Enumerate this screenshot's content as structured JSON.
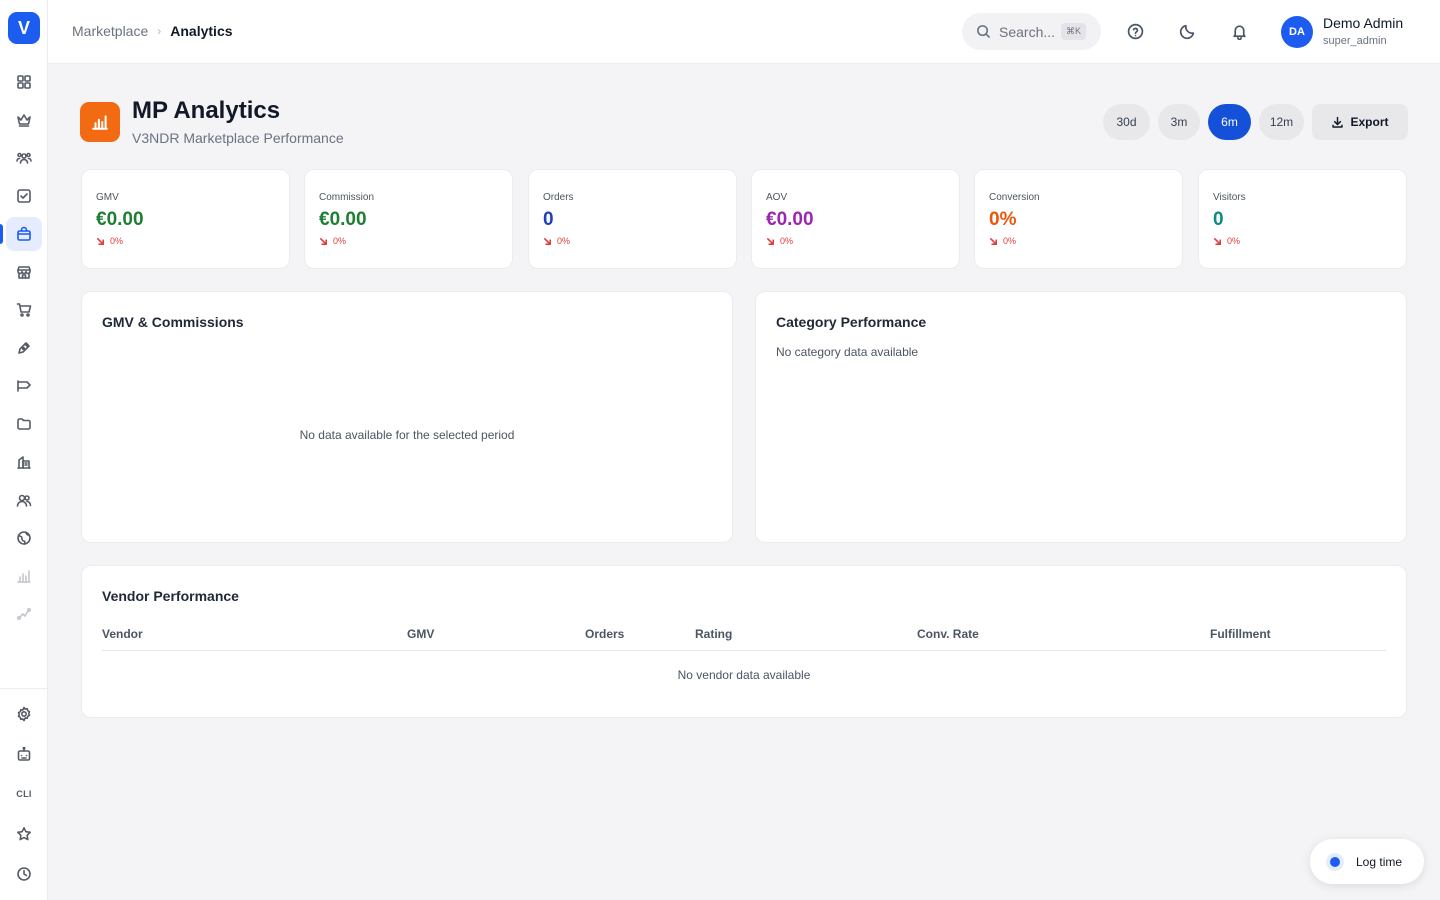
{
  "app": {
    "logo_letter": "V"
  },
  "breadcrumb": {
    "parent": "Marketplace",
    "current": "Analytics"
  },
  "search": {
    "placeholder": "Search...",
    "shortcut": "⌘K"
  },
  "user": {
    "initials": "DA",
    "name": "Demo Admin",
    "role": "super_admin"
  },
  "page": {
    "title": "MP Analytics",
    "subtitle": "V3NDR Marketplace Performance"
  },
  "ranges": [
    "30d",
    "3m",
    "6m",
    "12m"
  ],
  "active_range": "6m",
  "export_label": "Export",
  "kpis": [
    {
      "label": "GMV",
      "value": "€0.00",
      "delta": "0%",
      "color": "#1e7e34"
    },
    {
      "label": "Commission",
      "value": "€0.00",
      "delta": "0%",
      "color": "#1e7e34"
    },
    {
      "label": "Orders",
      "value": "0",
      "delta": "0%",
      "color": "#1f3fbf"
    },
    {
      "label": "AOV",
      "value": "€0.00",
      "delta": "0%",
      "color": "#9b27b0"
    },
    {
      "label": "Conversion",
      "value": "0%",
      "delta": "0%",
      "color": "#e8590c"
    },
    {
      "label": "Visitors",
      "value": "0",
      "delta": "0%",
      "color": "#0f8b80"
    }
  ],
  "gmv_panel": {
    "title": "GMV & Commissions",
    "empty": "No data available for the selected period"
  },
  "category_panel": {
    "title": "Category Performance",
    "empty": "No category data available"
  },
  "vendor_panel": {
    "title": "Vendor Performance",
    "columns": [
      "Vendor",
      "GMV",
      "Orders",
      "Rating",
      "Conv. Rate",
      "Fulfillment"
    ],
    "empty": "No vendor data available"
  },
  "sidebar_cli": "CLI",
  "log_time": "Log time",
  "colors": {
    "accent": "#1d5cf0",
    "page_icon": "#f26a11",
    "negative": "#e03d3d"
  }
}
